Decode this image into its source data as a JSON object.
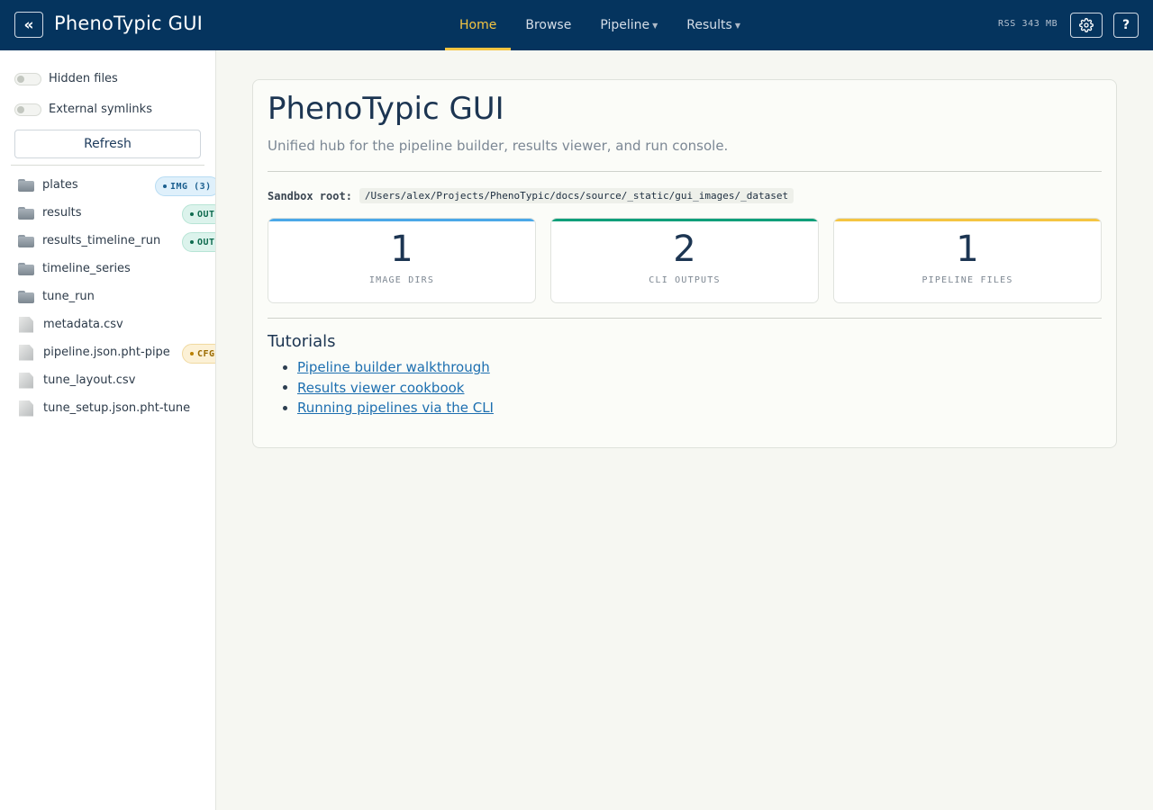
{
  "navbar": {
    "collapse_label": "«",
    "brand": "PhenoTypic GUI",
    "items": [
      {
        "label": "Home",
        "active": true,
        "dropdown": false
      },
      {
        "label": "Browse",
        "active": false,
        "dropdown": false
      },
      {
        "label": "Pipeline",
        "active": false,
        "dropdown": true
      },
      {
        "label": "Results",
        "active": false,
        "dropdown": true
      }
    ],
    "rss": "RSS 343 MB",
    "settings_icon": "gear-icon",
    "help_label": "?"
  },
  "sidebar": {
    "toggles": [
      {
        "label": "Hidden files",
        "on": false
      },
      {
        "label": "External symlinks",
        "on": false
      }
    ],
    "refresh_label": "Refresh",
    "items": [
      {
        "name": "plates",
        "type": "folder",
        "badge": "IMG (3)",
        "badge_kind": "img"
      },
      {
        "name": "results",
        "type": "folder",
        "badge": "OUT",
        "badge_kind": "out"
      },
      {
        "name": "results_timeline_run",
        "type": "folder",
        "badge": "OUT",
        "badge_kind": "out"
      },
      {
        "name": "timeline_series",
        "type": "folder",
        "badge": "",
        "badge_kind": ""
      },
      {
        "name": "tune_run",
        "type": "folder",
        "badge": "",
        "badge_kind": ""
      },
      {
        "name": "metadata.csv",
        "type": "file",
        "badge": "",
        "badge_kind": ""
      },
      {
        "name": "pipeline.json.pht-pipe",
        "type": "file",
        "badge": "CFG",
        "badge_kind": "cfg"
      },
      {
        "name": "tune_layout.csv",
        "type": "file",
        "badge": "",
        "badge_kind": ""
      },
      {
        "name": "tune_setup.json.pht-tune",
        "type": "file",
        "badge": "",
        "badge_kind": ""
      }
    ]
  },
  "main": {
    "title": "PhenoTypic GUI",
    "subtitle": "Unified hub for the pipeline builder, results viewer, and run console.",
    "sandbox_label": "Sandbox root:",
    "sandbox_path": "/Users/alex/Projects/PhenoTypic/docs/source/_static/gui_images/_dataset",
    "stats": [
      {
        "value": "1",
        "label": "IMAGE DIRS",
        "color": "#4aa8e8"
      },
      {
        "value": "2",
        "label": "CLI OUTPUTS",
        "color": "#0e9f7a"
      },
      {
        "value": "1",
        "label": "PIPELINE FILES",
        "color": "#f5c542"
      }
    ],
    "tutorials_heading": "Tutorials",
    "tutorials": [
      "Pipeline builder walkthrough",
      "Results viewer cookbook",
      "Running pipelines via the CLI"
    ]
  }
}
